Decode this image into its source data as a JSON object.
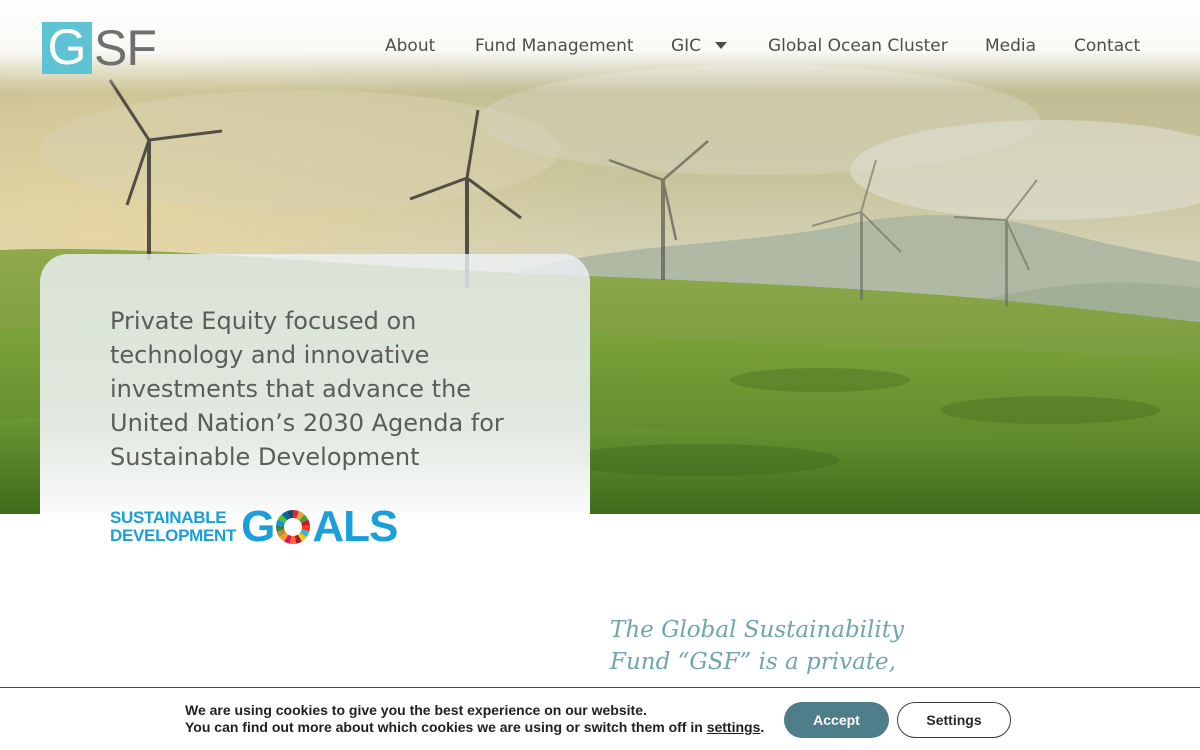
{
  "brand": {
    "logo_letter": "G",
    "logo_rest": "SF",
    "accent_color": "#5fc3d6"
  },
  "nav": {
    "items": [
      {
        "label": "About"
      },
      {
        "label": "Fund Management"
      },
      {
        "label": "GIC",
        "has_dropdown": true
      },
      {
        "label": "Global Ocean Cluster"
      },
      {
        "label": "Media"
      },
      {
        "label": "Contact"
      }
    ]
  },
  "hero": {
    "image": "wind-turbines-on-green-hills",
    "headline": "Private Equity focused on technology and innovative investments that advance the United Nation’s 2030 Agenda for Sustainable Development",
    "sdg_logo": {
      "line1": "SUSTAINABLE",
      "line2": "DEVELOPMENT",
      "big_before": "G",
      "big_after": "ALS",
      "color": "#1a9fd8"
    }
  },
  "intro": {
    "text": "The Global Sustainability Fund “GSF” is a private,"
  },
  "cookie_bar": {
    "line1": "We are using cookies to give you the best experience on our website.",
    "line2_prefix": "You can find out more about which cookies we are using or switch them off in",
    "line2_link": "settings",
    "line2_suffix": ".",
    "accept_label": "Accept",
    "settings_label": "Settings",
    "accept_color": "#4f7e8b"
  }
}
